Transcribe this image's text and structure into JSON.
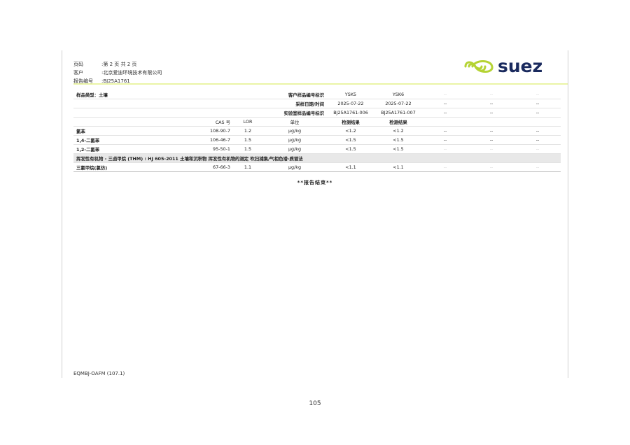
{
  "header": {
    "page_label": "页码",
    "page_value": ":第 2 页 共 2 页",
    "client_label": "客户",
    "client_value": ":北京爱迪环境技术有限公司",
    "report_label": "报告编号",
    "report_value": ":BJ25A1761"
  },
  "logo": {
    "text": "suez",
    "icon": "suez-swirl-logo-icon",
    "colors": {
      "lime": "#b5d334",
      "navy": "#1a2a5e"
    }
  },
  "table": {
    "meta_rows": [
      {
        "left": "样品类型：土壤",
        "label": "客户样品编号标识",
        "values": [
          "YSK5",
          "YSK6",
          "--",
          "--",
          "--"
        ]
      },
      {
        "left": "",
        "label": "采样日期/时间",
        "values": [
          "2025-07-22",
          "2025-07-22",
          "--",
          "--",
          "--"
        ]
      },
      {
        "left": "",
        "label": "实验室样品编号标识",
        "values": [
          "BJ25A1761-006",
          "BJ25A1761-007",
          "--",
          "--",
          "--"
        ]
      }
    ],
    "columns": {
      "cas": "CAS 号",
      "lor": "LOR",
      "unit": "单位",
      "r1": "检测结果",
      "r2": "检测结果"
    },
    "data_rows": [
      {
        "name": "氯苯",
        "cas": "108-90-7",
        "lor": "1.2",
        "unit": "μg/kg",
        "r1": "<1.2",
        "r2": "<1.2",
        "rest": [
          "--",
          "--",
          "--"
        ]
      },
      {
        "name": "1,4-二氯苯",
        "cas": "106-46-7",
        "lor": "1.5",
        "unit": "μg/kg",
        "r1": "<1.5",
        "r2": "<1.5",
        "rest": [
          "--",
          "--",
          "--"
        ]
      },
      {
        "name": "1,2-二氯苯",
        "cas": "95-50-1",
        "lor": "1.5",
        "unit": "μg/kg",
        "r1": "<1.5",
        "r2": "<1.5",
        "rest": [
          "--",
          "--",
          "--"
        ]
      }
    ],
    "section": "挥发性有机物 - 三卤甲烷 (THM) : HJ 605-2011 土壤和沉积物 挥发性有机物的测定 吹扫捕集/气相色谱-质谱法",
    "section_rows": [
      {
        "name": "三氯甲烷(氯仿)",
        "cas": "67-66-3",
        "lor": "1.1",
        "unit": "μg/kg",
        "r1": "<1.1",
        "r2": "<1.1",
        "rest": [
          "--",
          "--",
          "--"
        ]
      }
    ]
  },
  "end_text": "**报告结束**",
  "footer": "EQMBJ-OAFM (107.1)",
  "page_number": "105"
}
